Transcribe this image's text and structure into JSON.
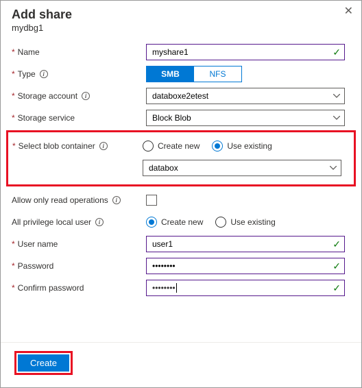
{
  "header": {
    "title": "Add share",
    "subtitle": "mydbg1"
  },
  "labels": {
    "name": "Name",
    "type": "Type",
    "storage_account": "Storage account",
    "storage_service": "Storage service",
    "select_blob_container": "Select blob container",
    "allow_read": "Allow only read operations",
    "all_privilege_user": "All privilege local user",
    "user_name": "User name",
    "password": "Password",
    "confirm_password": "Confirm password"
  },
  "values": {
    "name": "myshare1",
    "storage_account": "databoxe2etest",
    "storage_service": "Block Blob",
    "blob_container": "databox",
    "user_name": "user1",
    "password": "••••••••",
    "confirm_password": "••••••••"
  },
  "type_tabs": {
    "smb": "SMB",
    "nfs": "NFS",
    "selected": "SMB"
  },
  "radios": {
    "create_new": "Create new",
    "use_existing": "Use existing",
    "blob_selected": "use_existing",
    "user_selected": "create_new"
  },
  "footer": {
    "create": "Create"
  }
}
